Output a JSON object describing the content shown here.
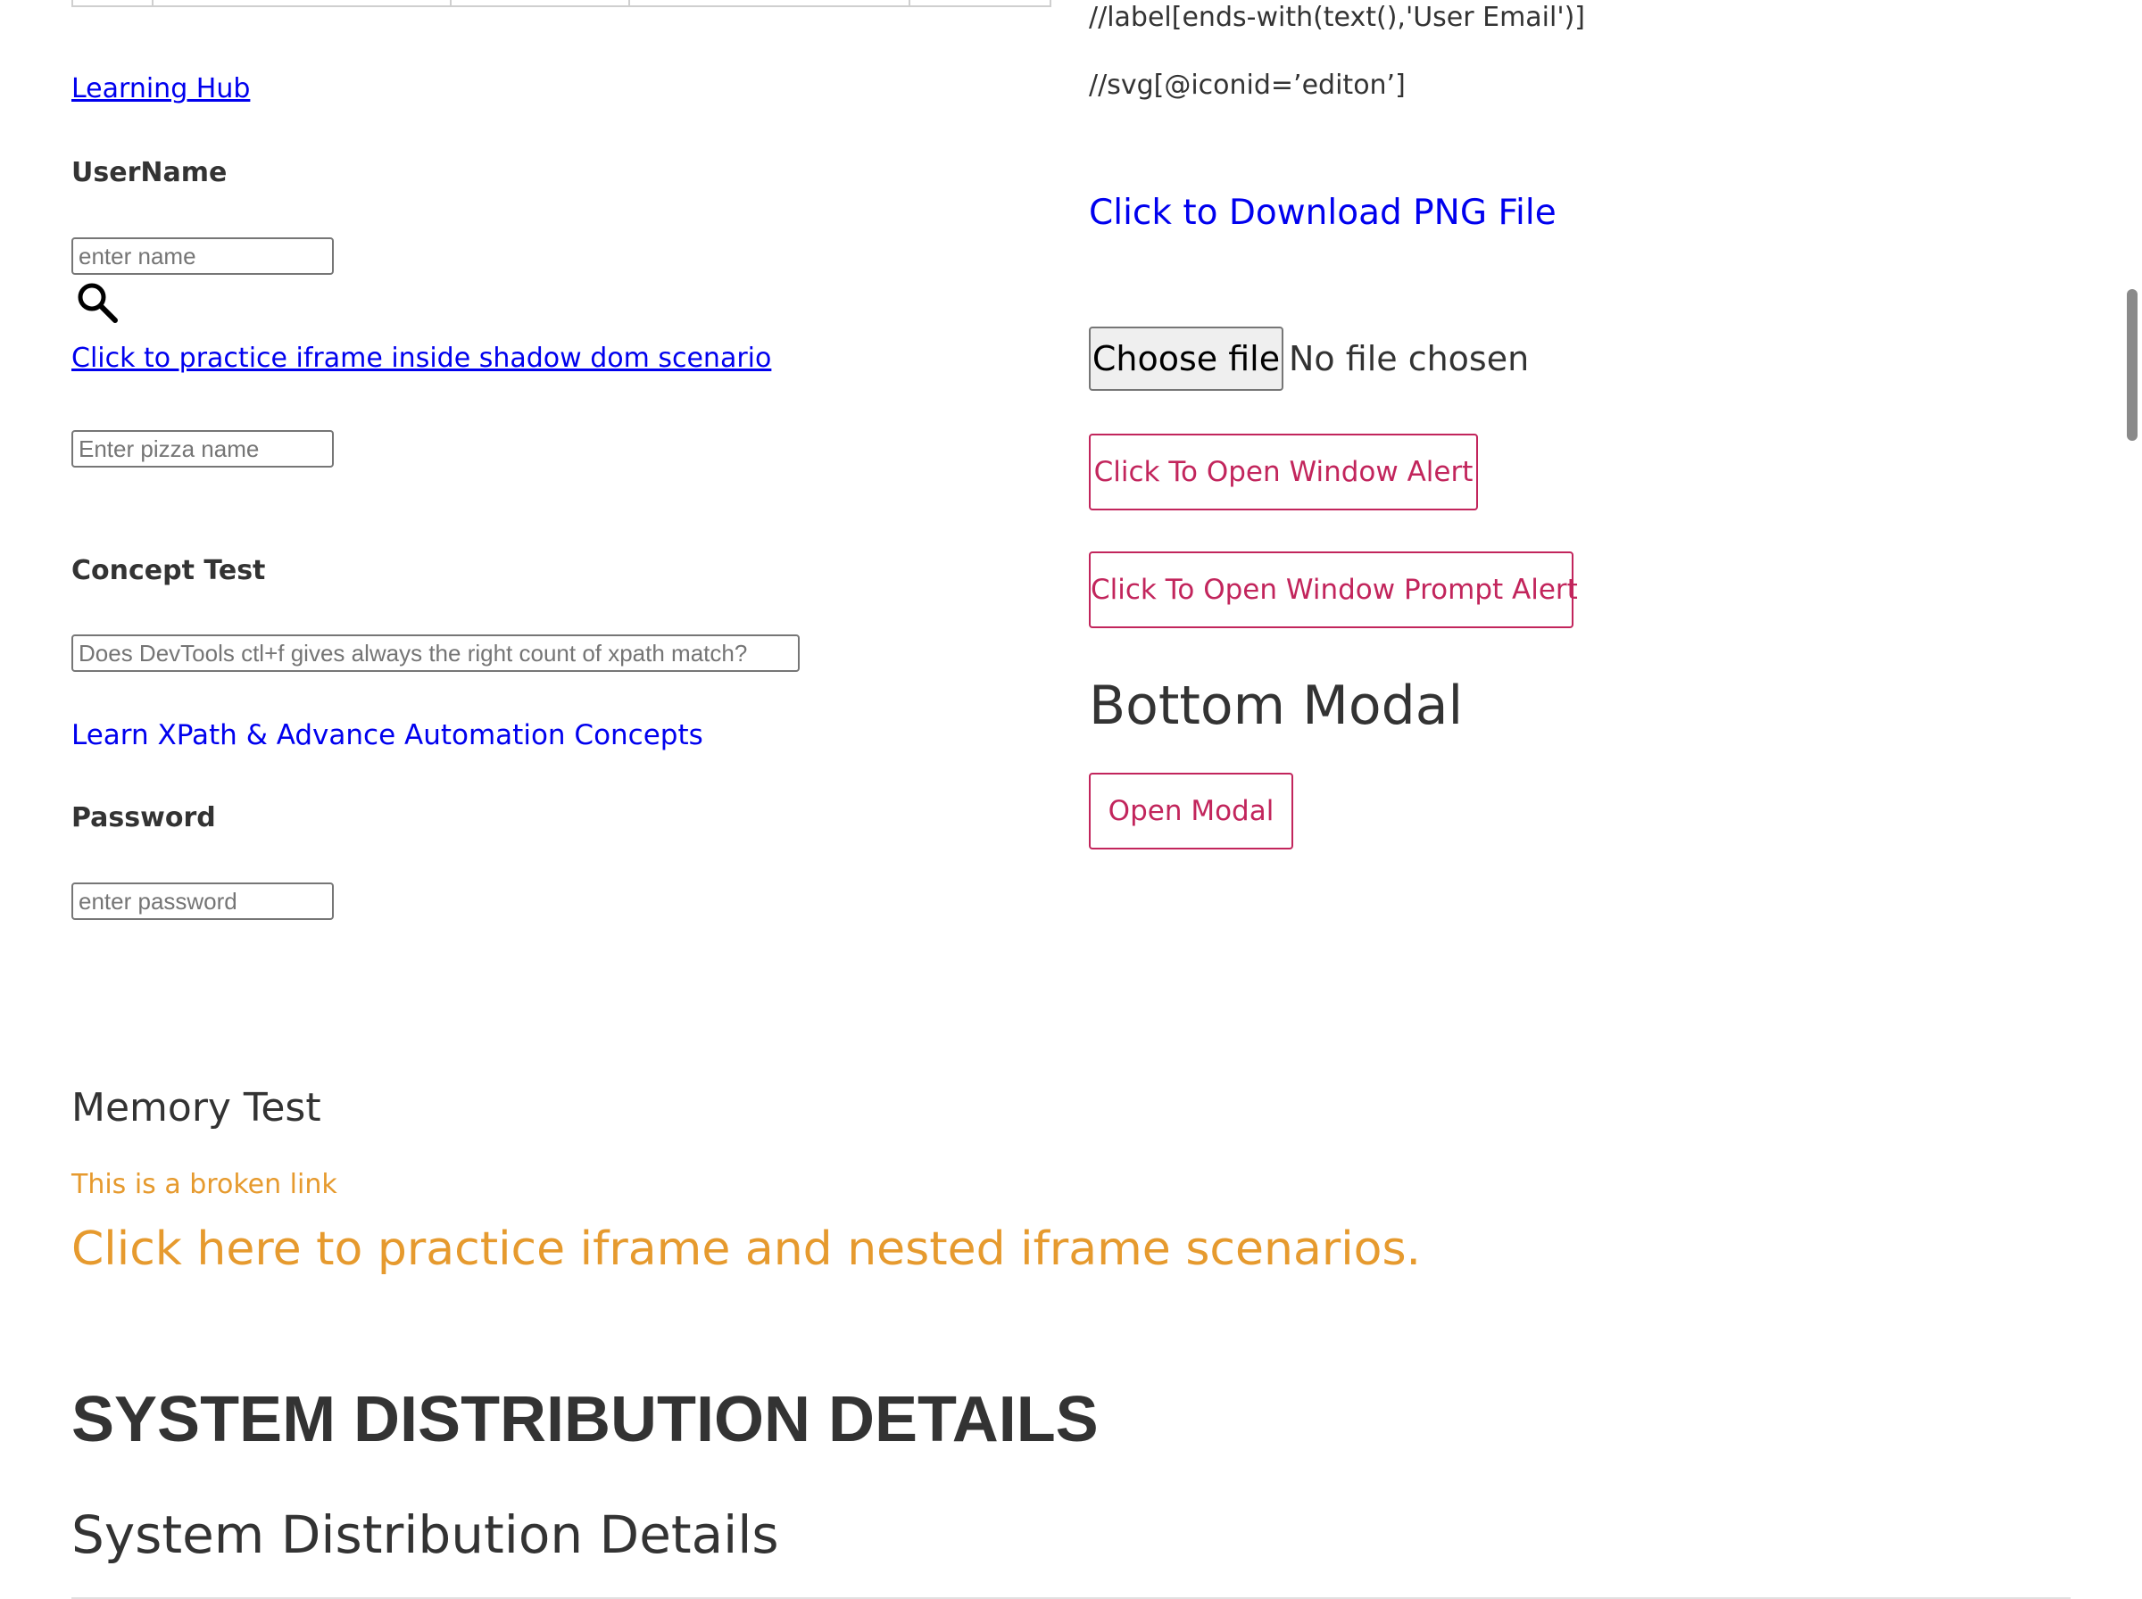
{
  "left": {
    "learning_hub_link": "Learning Hub",
    "username_label": "UserName",
    "username_placeholder": "enter name",
    "shadow_iframe_link": "Click to practice iframe inside shadow dom scenario",
    "pizza_placeholder": "Enter pizza name",
    "concept_test_label": "Concept Test",
    "concept_input_placeholder": "Does DevTools ctl+f gives always the right count of xpath match?",
    "learn_xpath_link": "Learn XPath & Advance Automation Concepts",
    "password_label": "Password",
    "password_placeholder": "enter password"
  },
  "right": {
    "xpath_line_1": "//label[ends-with(text(),'User Email')]",
    "xpath_line_2": "//svg[@iconid=’editon’]",
    "download_png_link": "Click to Download PNG File",
    "choose_file_label": "Choose file",
    "no_file_text": "No file chosen",
    "window_alert_button": "Click To Open Window Alert",
    "prompt_alert_button": "Click To Open Window Prompt Alert",
    "bottom_modal_heading": "Bottom Modal",
    "open_modal_button": "Open Modal"
  },
  "bottom": {
    "memory_test_heading": "Memory Test",
    "broken_link_text": "This is a broken link",
    "iframe_practice_link": "Click here to practice iframe and nested iframe scenarios.",
    "system_heading_upper": "SYSTEM DISTRIBUTION DETAILS",
    "system_heading": "System Distribution Details"
  },
  "colors": {
    "link": "#0000ee",
    "button_accent": "#c2255c",
    "orange": "#e69a2e",
    "text": "#333333"
  },
  "icons": {
    "search": "search-icon"
  }
}
